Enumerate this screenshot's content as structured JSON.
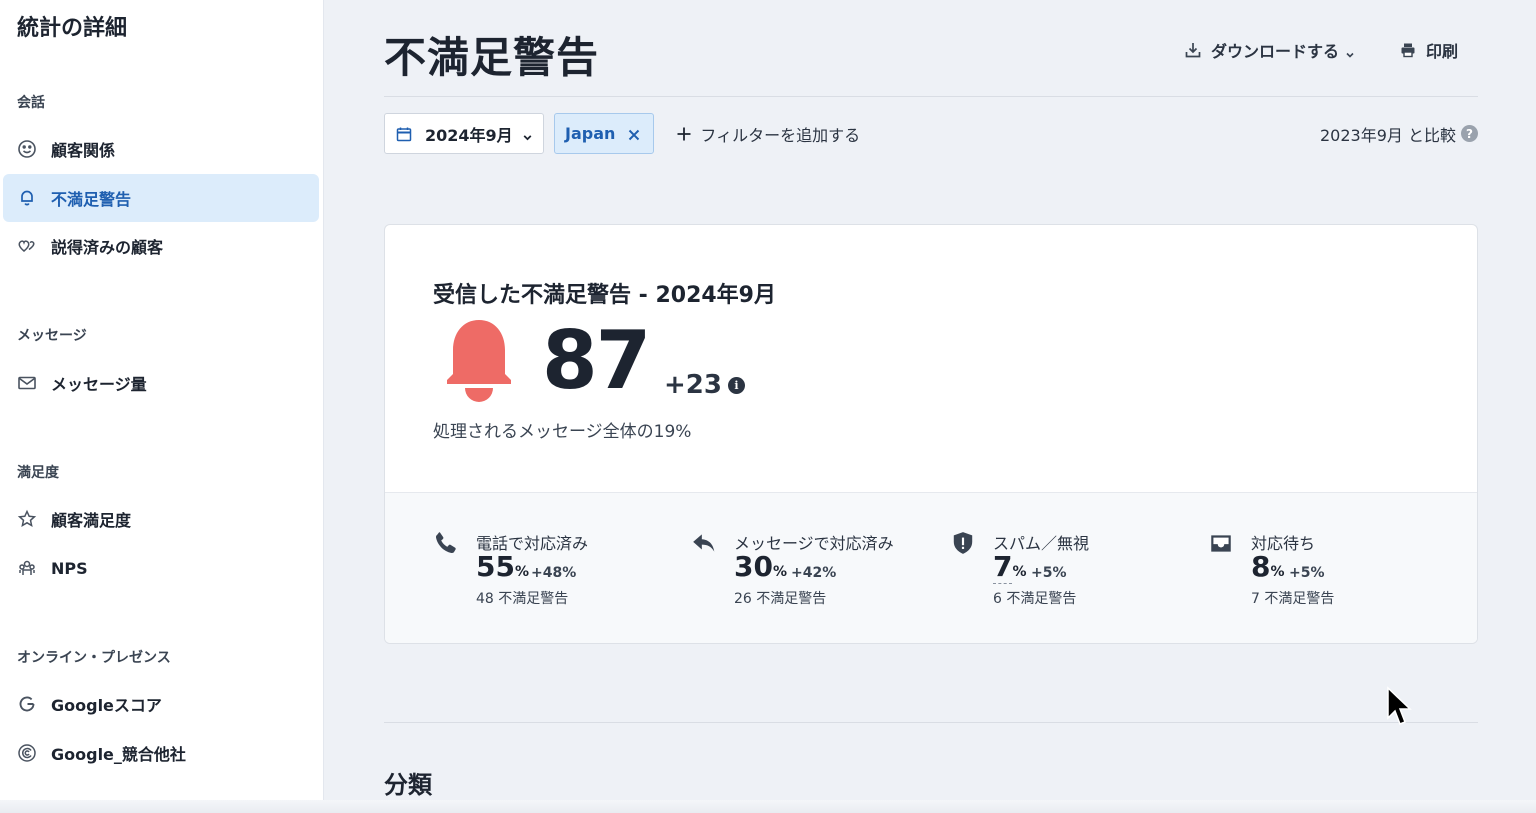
{
  "sidebar": {
    "title": "統計の詳細",
    "sections": [
      {
        "label": "会話"
      },
      {
        "label": "メッセージ"
      },
      {
        "label": "満足度"
      },
      {
        "label": "オンライン・プレゼンス"
      }
    ],
    "items": [
      {
        "label": "顧客関係",
        "icon": "smile-icon"
      },
      {
        "label": "不満足警告",
        "icon": "bell-icon",
        "active": true
      },
      {
        "label": "説得済みの顧客",
        "icon": "hearts-icon"
      },
      {
        "label": "メッセージ量",
        "icon": "envelope-icon"
      },
      {
        "label": "顧客満足度",
        "icon": "star-icon"
      },
      {
        "label": "NPS",
        "icon": "nps-icon"
      },
      {
        "label": "Googleスコア",
        "icon": "google-icon"
      },
      {
        "label": "Google_競合他社",
        "icon": "competitor-icon"
      }
    ]
  },
  "header": {
    "title": "不満足警告",
    "download_label": "ダウンロードする",
    "print_label": "印刷"
  },
  "filters": {
    "date_label": "2024年9月",
    "chip_label": "Japan",
    "add_filter_label": "フィルターを追加する",
    "compare_label": "2023年9月 と比較",
    "help_glyph": "?"
  },
  "card": {
    "title": "受信した不満足警告 - 2024年9月",
    "value": "87",
    "delta": "+23",
    "info_glyph": "i",
    "subtitle": "処理されるメッセージ全体の19%",
    "stats": [
      {
        "name": "電話で対応済み",
        "pct": "55",
        "unit": "%",
        "change": "+48%",
        "count": "48 不満足警告",
        "icon": "phone-icon"
      },
      {
        "name": "メッセージで対応済み",
        "pct": "30",
        "unit": "%",
        "change": "+42%",
        "count": "26 不満足警告",
        "icon": "reply-icon"
      },
      {
        "name": "スパム／無視",
        "pct": "7",
        "unit": "%",
        "change": "+5%",
        "count": "6 不満足警告",
        "icon": "shield-icon"
      },
      {
        "name": "対応待ち",
        "pct": "8",
        "unit": "%",
        "change": "+5%",
        "count": "7 不満足警告",
        "icon": "inbox-icon"
      }
    ]
  },
  "section": {
    "title": "分類"
  },
  "colors": {
    "accent": "#1f5fb0",
    "active_bg": "#dcecfb",
    "bell": "#ee6b66",
    "background": "#eef1f6"
  }
}
